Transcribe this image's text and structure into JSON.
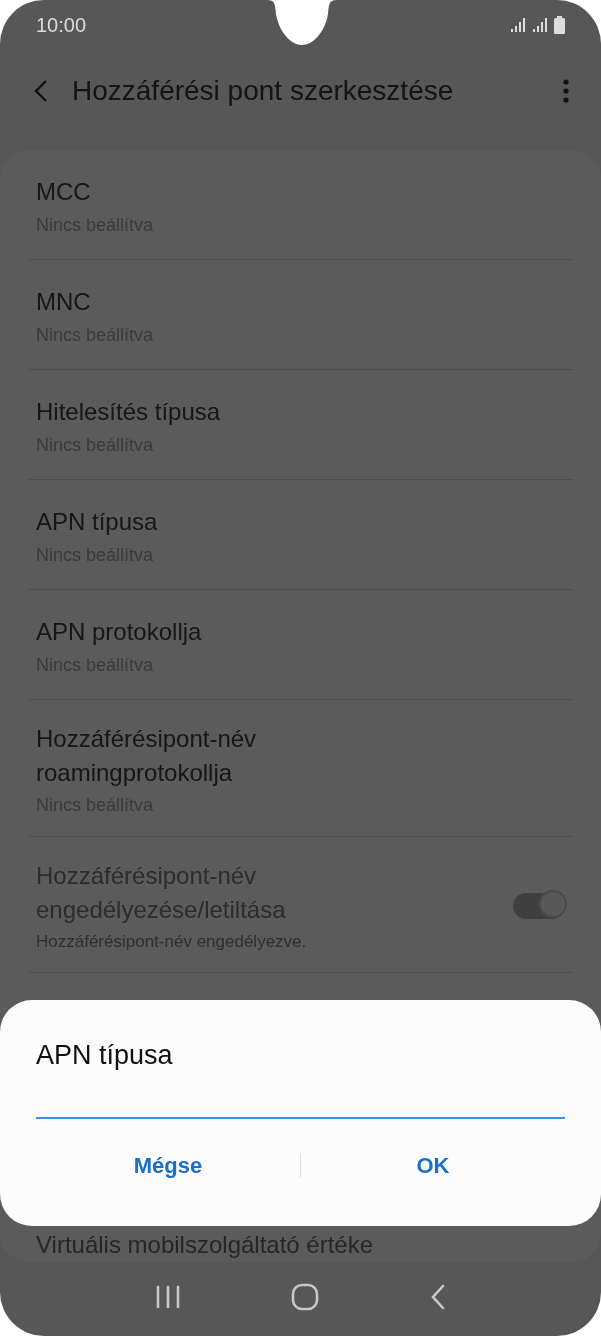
{
  "status_bar": {
    "time": "10:00"
  },
  "app_bar": {
    "title": "Hozzáférési pont szerkesztése"
  },
  "items": [
    {
      "kind": "value",
      "title": "MCC",
      "subtitle": "Nincs beállítva",
      "disabled": false
    },
    {
      "kind": "value",
      "title": "MNC",
      "subtitle": "Nincs beállítva",
      "disabled": false
    },
    {
      "kind": "value",
      "title": "Hitelesítés típusa",
      "subtitle": "Nincs beállítva",
      "disabled": false
    },
    {
      "kind": "value",
      "title": "APN típusa",
      "subtitle": "Nincs beállítva",
      "disabled": false
    },
    {
      "kind": "value",
      "title": "APN protokollja",
      "subtitle": "Nincs beállítva",
      "disabled": false
    },
    {
      "kind": "value",
      "title": "Hozzáférésipont-név roamingprotokollja",
      "subtitle": "Nincs beállítva",
      "disabled": false
    },
    {
      "kind": "toggle",
      "title": "Hozzáférésipont-név engedélyezése/letiltása",
      "subtitle": "Hozzáférésipont-név engedélyezve.",
      "disabled": true,
      "on": true
    }
  ],
  "partial_item": {
    "title": "Virtuális mobilszolgáltató értéke"
  },
  "dialog": {
    "title": "APN típusa",
    "buttons": [
      "Mégse",
      "OK"
    ]
  }
}
